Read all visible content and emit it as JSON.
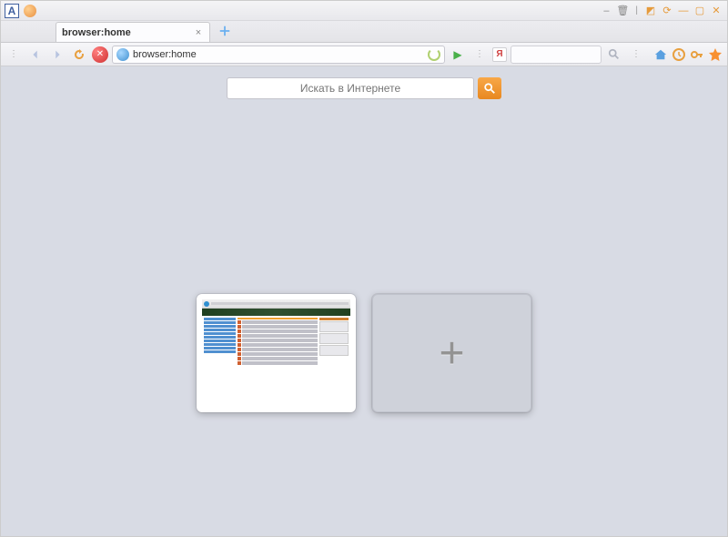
{
  "window": {
    "title": "browser:home"
  },
  "tabs": {
    "active": {
      "title": "browser:home"
    }
  },
  "toolbar": {
    "address": "browser:home"
  },
  "search": {
    "placeholder": "Искать в Интернете"
  },
  "speeddial": {
    "add_label": "+"
  }
}
